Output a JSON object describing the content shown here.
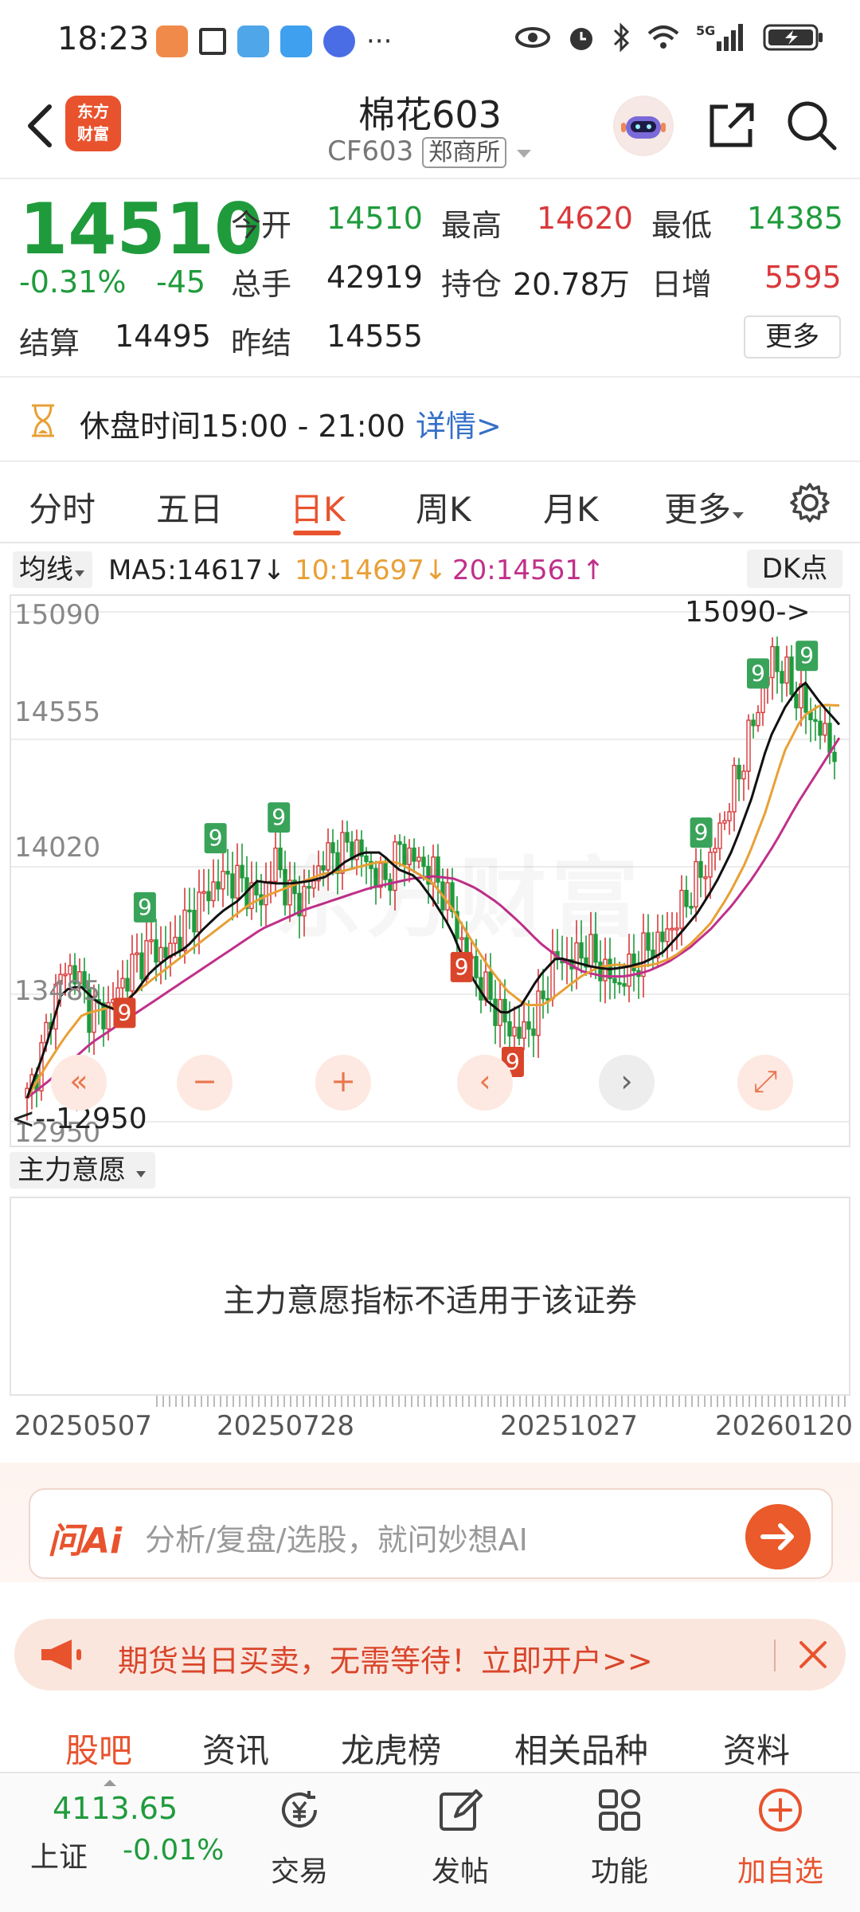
{
  "status_bar": {
    "time": "18:23",
    "more": "···",
    "signal": "5G"
  },
  "header": {
    "back_icon": "chevron-left-icon",
    "logo_text": "东方财富",
    "title": "棉花603",
    "code": "CF603",
    "exchange": "郑商所"
  },
  "quote": {
    "price": "14510",
    "change_pct": "-0.31%",
    "change": "-45",
    "open_label": "今开",
    "open": "14510",
    "high_label": "最高",
    "high": "14620",
    "low_label": "最低",
    "low": "14385",
    "volume_label": "总手",
    "volume": "42919",
    "oi_label": "持仓",
    "oi": "20.78万",
    "daily_inc_label": "日增",
    "daily_inc": "5595",
    "settle_label": "结算",
    "settle": "14495",
    "prev_settle_label": "昨结",
    "prev_settle": "14555",
    "more_label": "更多"
  },
  "notice": {
    "text": "休盘时间15:00 - 21:00",
    "link": "详情>"
  },
  "period_tabs": [
    "分时",
    "五日",
    "日K",
    "周K",
    "月K",
    "更多"
  ],
  "active_tab": "日K",
  "ma_row": {
    "select_label": "均线",
    "ma5": "MA5:14617↓",
    "ma10": "10:14697↓",
    "ma20": "20:14561↑",
    "dk_label": "DK点"
  },
  "colors": {
    "up": "#d9393b",
    "down": "#1f9b3c",
    "ma5": "#111111",
    "ma10": "#e8a035",
    "ma20": "#c0308a",
    "accent": "#e8532e"
  },
  "chart_data": {
    "type": "candlestick",
    "y_ticks": [
      "15090",
      "14555",
      "14020",
      "13485",
      "12950"
    ],
    "high_annotation": "15090->",
    "low_annotation": "<--12950",
    "x_labels": [
      "20250507",
      "20250728",
      "20251027",
      "20260120"
    ],
    "ylim": [
      12950,
      15090
    ],
    "close_path": [
      13050,
      13250,
      13550,
      13600,
      13420,
      13400,
      13520,
      13620,
      13680,
      13650,
      13760,
      13860,
      13940,
      13980,
      13940,
      13870,
      14050,
      13880,
      13900,
      14050,
      14080,
      14120,
      14020,
      13950,
      14100,
      14050,
      14000,
      13900,
      13700,
      13550,
      13450,
      13340,
      13320,
      13420,
      13640,
      13620,
      13670,
      13600,
      13520,
      13600,
      13680,
      13720,
      13820,
      13950,
      14050,
      14250,
      14450,
      14680,
      14900,
      14800,
      14700,
      14600,
      14510
    ],
    "ma5": [
      13050,
      13250,
      13500,
      13520,
      13450,
      13420,
      13480,
      13580,
      13640,
      13680,
      13760,
      13830,
      13880,
      13960,
      13950,
      13950,
      13960,
      13980,
      14040,
      14080,
      14080,
      14010,
      13980,
      13880,
      13760,
      13580,
      13460,
      13400,
      13440,
      13560,
      13640,
      13620,
      13600,
      13590,
      13600,
      13620,
      13660,
      13740,
      13830,
      13950,
      14100,
      14300,
      14550,
      14700,
      14800,
      14700,
      14617
    ],
    "ma10": [
      13050,
      13180,
      13300,
      13400,
      13420,
      13440,
      13500,
      13560,
      13620,
      13680,
      13740,
      13800,
      13860,
      13900,
      13930,
      13960,
      13990,
      14000,
      14020,
      14040,
      14040,
      14000,
      13950,
      13850,
      13720,
      13600,
      13500,
      13440,
      13440,
      13500,
      13560,
      13600,
      13610,
      13600,
      13610,
      13640,
      13700,
      13780,
      13900,
      14050,
      14250,
      14500,
      14650,
      14700,
      14697
    ],
    "ma20": [
      13050,
      13120,
      13200,
      13280,
      13340,
      13400,
      13460,
      13520,
      13580,
      13640,
      13700,
      13760,
      13800,
      13840,
      13870,
      13900,
      13930,
      13950,
      13970,
      13980,
      13970,
      13930,
      13870,
      13790,
      13700,
      13630,
      13580,
      13560,
      13560,
      13580,
      13620,
      13680,
      13760,
      13860,
      13980,
      14120,
      14280,
      14420,
      14561
    ],
    "signals": [
      {
        "label": "9",
        "color": "green",
        "i": 0.145
      },
      {
        "label": "9",
        "color": "green",
        "i": 0.232
      },
      {
        "label": "9",
        "color": "green",
        "i": 0.31
      },
      {
        "label": "9",
        "color": "red",
        "i": 0.12
      },
      {
        "label": "9",
        "color": "red",
        "i": 0.535
      },
      {
        "label": "9",
        "color": "red",
        "i": 0.598
      },
      {
        "label": "9",
        "color": "green",
        "i": 0.83
      },
      {
        "label": "9",
        "color": "green",
        "i": 0.9
      },
      {
        "label": "9",
        "color": "green",
        "i": 0.96
      }
    ]
  },
  "indicator": {
    "select_label": "主力意愿",
    "message": "主力意愿指标不适用于该证券"
  },
  "ai_bar": {
    "logo": "问Ai",
    "placeholder": "分析/复盘/选股，就问妙想AI"
  },
  "promo": {
    "text": "期货当日买卖，无需等待！立即开户>>"
  },
  "bottom_tabs": [
    "股吧",
    "资讯",
    "龙虎榜",
    "相关品种",
    "资料"
  ],
  "bottom_nav": {
    "index_value": "4113.65",
    "index_name": "上证",
    "index_change": "-0.01%",
    "items": [
      "交易",
      "发帖",
      "功能",
      "加自选"
    ]
  }
}
